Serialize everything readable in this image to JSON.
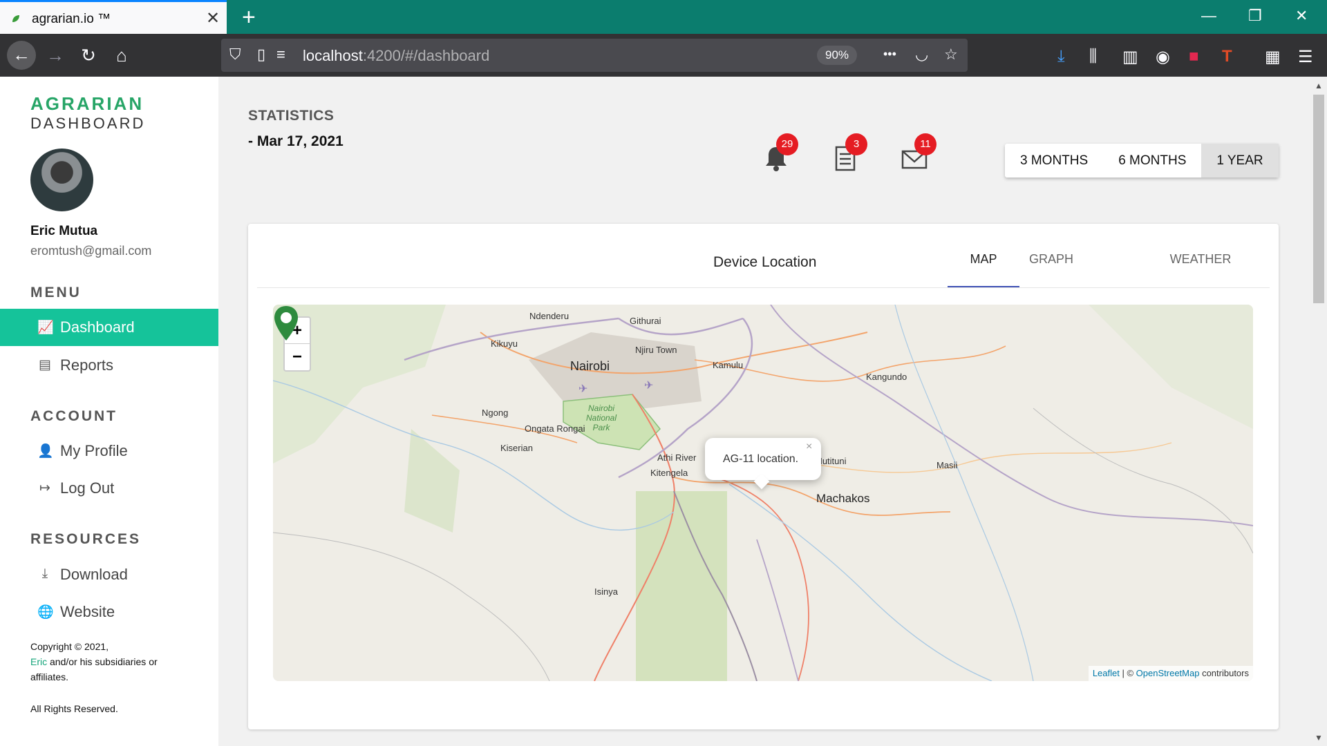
{
  "browser": {
    "tab_title": "agrarian.io ™",
    "tab_close": "✕",
    "new_tab": "+",
    "url_host": "localhost",
    "url_rest": ":4200/#/dashboard",
    "zoom": "90%",
    "more": "•••"
  },
  "sidebar": {
    "brand_top": "AGRARIAN",
    "brand_bottom": "DASHBOARD",
    "user_name": "Eric Mutua",
    "user_email": "eromtush@gmail.com",
    "sections": {
      "menu": "MENU",
      "account": "ACCOUNT",
      "resources": "RESOURCES"
    },
    "menu_items": [
      {
        "label": "Dashboard",
        "icon": "chart-icon"
      },
      {
        "label": "Reports",
        "icon": "report-icon"
      }
    ],
    "account_items": [
      {
        "label": "My Profile",
        "icon": "person-icon"
      },
      {
        "label": "Log Out",
        "icon": "logout-icon"
      }
    ],
    "resource_items": [
      {
        "label": "Download",
        "icon": "download-icon"
      },
      {
        "label": "Website",
        "icon": "globe-icon"
      }
    ],
    "copyright_line": "Copyright © 2021,",
    "copyright_link": "Eric",
    "copyright_rest": " and/or his subsidiaries or affiliates.",
    "rights": "All Rights Reserved."
  },
  "main": {
    "stats_title": "STATISTICS",
    "date_label": "- Mar 17, 2021",
    "notifications": {
      "bell": "29",
      "doc": "3",
      "mail": "11"
    },
    "periods": [
      "3 MONTHS",
      "6 MONTHS",
      "1 YEAR"
    ],
    "selected_period": "1 YEAR"
  },
  "card": {
    "title": "Device Location",
    "tabs": [
      "GRAPH",
      "MAP",
      "WEATHER"
    ],
    "selected_tab": "MAP"
  },
  "map": {
    "zoom_in": "+",
    "zoom_out": "−",
    "places": {
      "ndenderu": "Ndenderu",
      "githurai": "Githurai",
      "kikuyu": "Kikuyu",
      "njiru": "Njiru Town",
      "nairobi": "Nairobi",
      "kamulu": "Kamulu",
      "kangundo": "Kangundo",
      "ngong": "Ngong",
      "ongata": "Ongata Rongai",
      "kiserian": "Kiserian",
      "athi": "Athi River",
      "kitengela": "Kitengela",
      "mutituni": "Mutituni",
      "masii": "Masii",
      "machakos": "Machakos",
      "isinya": "Isinya"
    },
    "park_label": "Nairobi National Park",
    "popup_text": "AG-11 location.",
    "popup_close": "×",
    "attribution": {
      "leaflet": "Leaflet",
      "sep": " | © ",
      "osm": "OpenStreetMap",
      "rest": " contributors"
    }
  },
  "colors": {
    "accent": "#15c39a",
    "brand_green": "#27a567",
    "badge": "#e51c23",
    "tab_underline": "#3f51b5",
    "marker": "#2e8b3e"
  }
}
